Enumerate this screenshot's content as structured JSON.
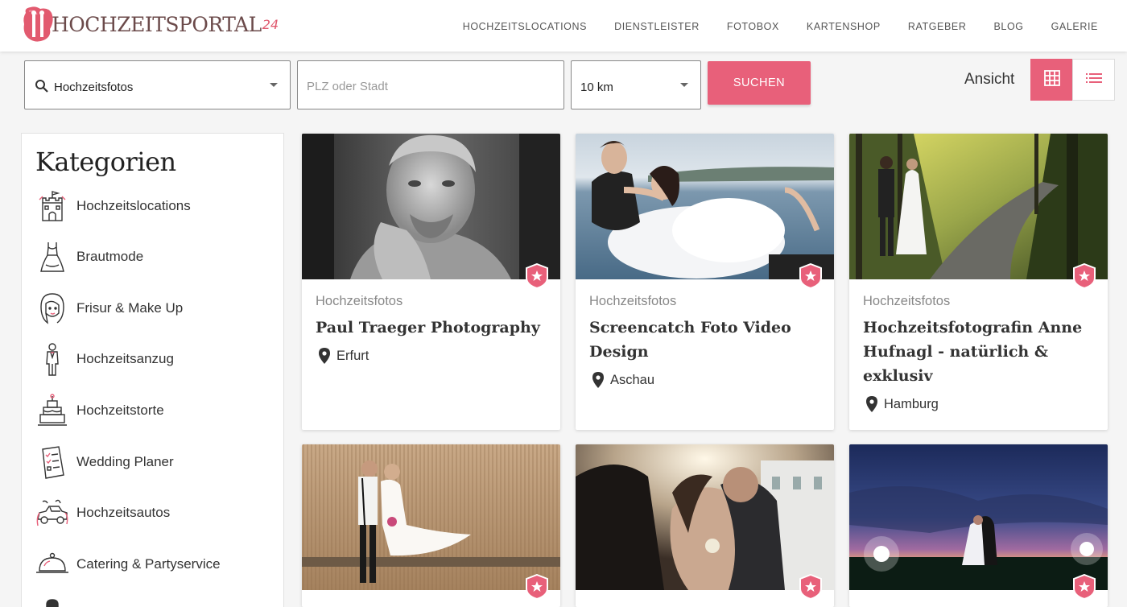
{
  "brand": {
    "name": "HOCHZEITSPORTAL",
    "suffix": "24"
  },
  "nav": [
    "HOCHZEITSLOCATIONS",
    "DIENSTLEISTER",
    "FOTOBOX",
    "KARTENSHOP",
    "RATGEBER",
    "BLOG",
    "GALERIE"
  ],
  "search": {
    "category_value": "Hochzeitsfotos",
    "location_placeholder": "PLZ oder Stadt",
    "radius_value": "10 km",
    "button_label": "SUCHEN"
  },
  "view": {
    "label": "Ansicht",
    "active": "grid"
  },
  "sidebar": {
    "title": "Kategorien",
    "items": [
      {
        "label": "Hochzeitslocations",
        "icon": "castle-icon"
      },
      {
        "label": "Brautmode",
        "icon": "wedding-dress-icon"
      },
      {
        "label": "Frisur & Make Up",
        "icon": "bride-face-icon"
      },
      {
        "label": "Hochzeitsanzug",
        "icon": "groom-suit-icon"
      },
      {
        "label": "Hochzeitstorte",
        "icon": "wedding-cake-icon"
      },
      {
        "label": "Wedding Planer",
        "icon": "checklist-icon"
      },
      {
        "label": "Hochzeitsautos",
        "icon": "wedding-car-icon"
      },
      {
        "label": "Catering & Partyservice",
        "icon": "cloche-icon"
      }
    ]
  },
  "cards": [
    {
      "category": "Hochzeitsfotos",
      "title": "Paul Traeger Photography",
      "location": "Erfurt"
    },
    {
      "category": "Hochzeitsfotos",
      "title": "Screencatch Foto Video Design",
      "location": "Aschau"
    },
    {
      "category": "Hochzeitsfotos",
      "title": "Hochzeitsfotografin Anne Hufnagl - natürlich & exklusiv",
      "location": "Hamburg"
    }
  ],
  "colors": {
    "accent": "#e8607a",
    "text": "#333333",
    "muted": "#888888",
    "background": "#f5f5f5"
  }
}
